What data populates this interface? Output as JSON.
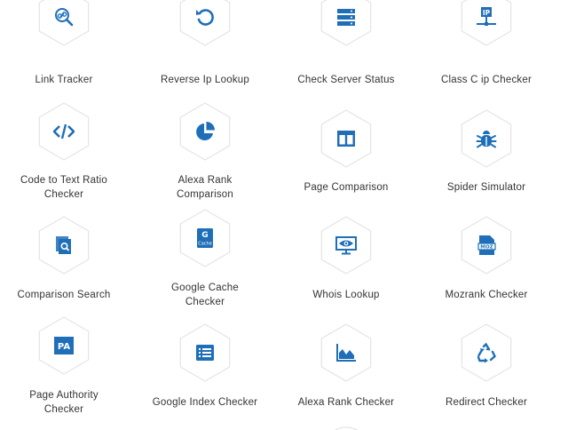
{
  "accent": "#1f6fb8",
  "hex_border": "#e4e4e4",
  "tools": [
    {
      "label_lines": [
        "Link Tracker"
      ],
      "icon": "link-search-icon"
    },
    {
      "label_lines": [
        "Reverse Ip Lookup"
      ],
      "icon": "undo-arrow-icon"
    },
    {
      "label_lines": [
        "Check Server Status"
      ],
      "icon": "server-icon"
    },
    {
      "label_lines": [
        "Class C ip Checker"
      ],
      "icon": "ip-network-icon"
    },
    {
      "label_lines": [
        "Code to Text Ratio",
        "Checker"
      ],
      "icon": "code-icon"
    },
    {
      "label_lines": [
        "Alexa Rank",
        "Comparison"
      ],
      "icon": "pie-chart-icon"
    },
    {
      "label_lines": [
        "Page Comparison"
      ],
      "icon": "columns-icon"
    },
    {
      "label_lines": [
        "Spider Simulator"
      ],
      "icon": "bug-icon"
    },
    {
      "label_lines": [
        "Comparison Search"
      ],
      "icon": "document-search-icon"
    },
    {
      "label_lines": [
        "Google Cache",
        "Checker"
      ],
      "icon": "google-cache-icon",
      "icon_text_top": "G",
      "icon_text_bottom": "Cache"
    },
    {
      "label_lines": [
        "Whois Lookup"
      ],
      "icon": "monitor-eye-icon"
    },
    {
      "label_lines": [
        "Mozrank Checker"
      ],
      "icon": "moz-document-icon",
      "icon_text": "MOZ"
    },
    {
      "label_lines": [
        "Page Authority",
        "Checker"
      ],
      "icon": "pa-badge-icon",
      "icon_text": "PA"
    },
    {
      "label_lines": [
        "Google Index Checker"
      ],
      "icon": "list-icon"
    },
    {
      "label_lines": [
        "Alexa Rank Checker"
      ],
      "icon": "area-chart-icon"
    },
    {
      "label_lines": [
        "Redirect Checker"
      ],
      "icon": "recycle-icon"
    }
  ]
}
